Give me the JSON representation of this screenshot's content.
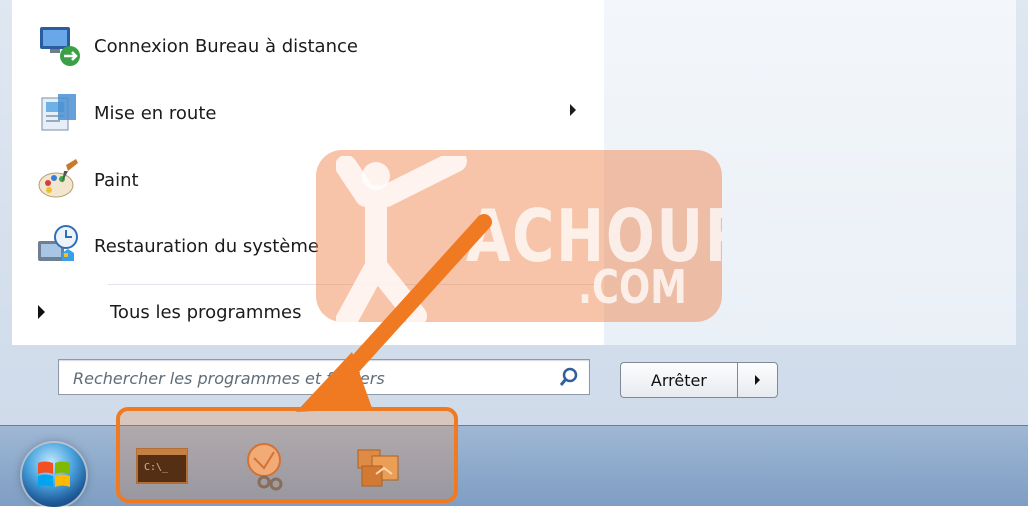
{
  "programs": [
    {
      "label": "Connexion Bureau à distance",
      "icon": "remote-desktop-icon"
    },
    {
      "label": "Mise en route",
      "icon": "getting-started-icon",
      "has_submenu": true
    },
    {
      "label": "Paint",
      "icon": "paint-palette-icon"
    },
    {
      "label": "Restauration du système",
      "icon": "system-restore-icon"
    }
  ],
  "all_programs_label": "Tous les programmes",
  "search": {
    "placeholder": "Rechercher les programmes et fichiers"
  },
  "shutdown": {
    "label": "Arrêter"
  },
  "taskbar": {
    "pinned": [
      {
        "name": "command-prompt-icon",
        "text": "C:\\_"
      },
      {
        "name": "snipping-tool-icon"
      },
      {
        "name": "image-folder-icon"
      }
    ]
  },
  "watermark": {
    "word": "ACHOURI",
    "suffix": ".COM"
  },
  "colors": {
    "highlight": "#f07a22",
    "watermark": "#ef7c40",
    "taskbar": "#8eabcc"
  }
}
